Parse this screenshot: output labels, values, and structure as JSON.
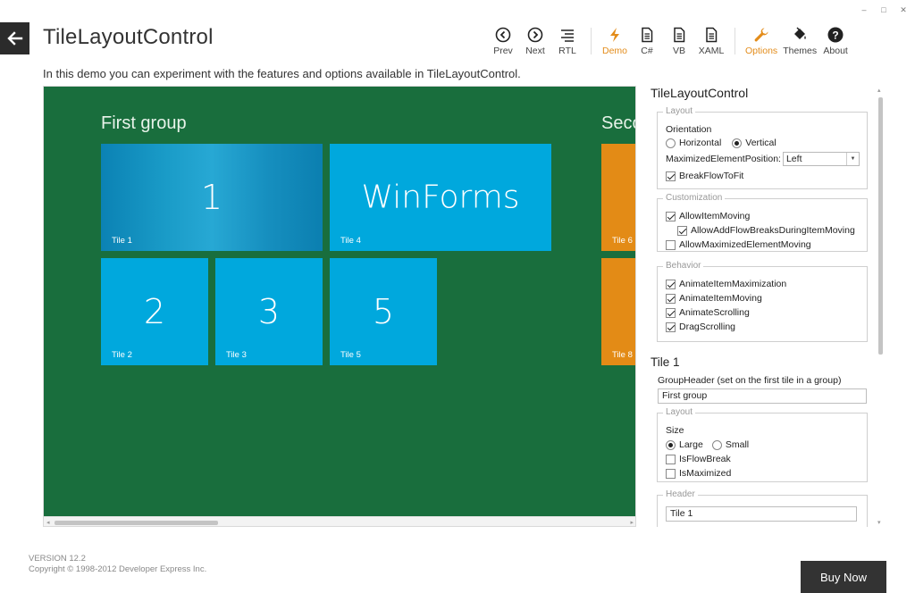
{
  "window": {
    "minimize": "–",
    "maximize": "□",
    "close": "✕"
  },
  "header": {
    "title": "TileLayoutControl",
    "description": "In this demo you can experiment with the features and options available in TileLayoutControl."
  },
  "toolbar": {
    "prev": "Prev",
    "next": "Next",
    "rtl": "RTL",
    "demo": "Demo",
    "cs": "C#",
    "vb": "VB",
    "xaml": "XAML",
    "options": "Options",
    "themes": "Themes",
    "about": "About",
    "active_color": "#e38c1a"
  },
  "demo": {
    "group1_header": "First group",
    "group2_header": "Seco",
    "tiles": [
      {
        "caption": "Tile 1",
        "content": "1"
      },
      {
        "caption": "Tile 4",
        "content": "WinForms"
      },
      {
        "caption": "Tile 2",
        "content": "2"
      },
      {
        "caption": "Tile 3",
        "content": "3"
      },
      {
        "caption": "Tile 5",
        "content": "5"
      },
      {
        "caption": "Tile 6",
        "content": ""
      },
      {
        "caption": "Tile 8",
        "content": ""
      }
    ],
    "colors": {
      "background": "#196e3d",
      "tile_blue": "#00a8dd",
      "tile_orange": "#e38b16"
    }
  },
  "options": {
    "title": "TileLayoutControl",
    "layout": {
      "legend": "Layout",
      "orientation_label": "Orientation",
      "horizontal": "Horizontal",
      "vertical": "Vertical",
      "maximized_label": "MaximizedElementPosition:",
      "maximized_value": "Left",
      "break_flow": "BreakFlowToFit"
    },
    "customization": {
      "legend": "Customization",
      "allow_item_moving": "AllowItemMoving",
      "allow_add_flow_breaks": "AllowAddFlowBreaksDuringItemMoving",
      "allow_maximized_moving": "AllowMaximizedElementMoving"
    },
    "behavior": {
      "legend": "Behavior",
      "animate_max": "AnimateItemMaximization",
      "animate_moving": "AnimateItemMoving",
      "animate_scrolling": "AnimateScrolling",
      "drag_scrolling": "DragScrolling"
    },
    "tile": {
      "title": "Tile 1",
      "group_header_label": "GroupHeader (set on the first tile in a group)",
      "group_header_value": "First group",
      "layout_legend": "Layout",
      "size_label": "Size",
      "large": "Large",
      "small": "Small",
      "is_flow_break": "IsFlowBreak",
      "is_maximized": "IsMaximized",
      "header_legend": "Header",
      "header_value": "Tile 1"
    }
  },
  "footer": {
    "version": "VERSION 12.2",
    "copyright": "Copyright © 1998-2012 Developer Express Inc.",
    "buy_now": "Buy Now"
  }
}
